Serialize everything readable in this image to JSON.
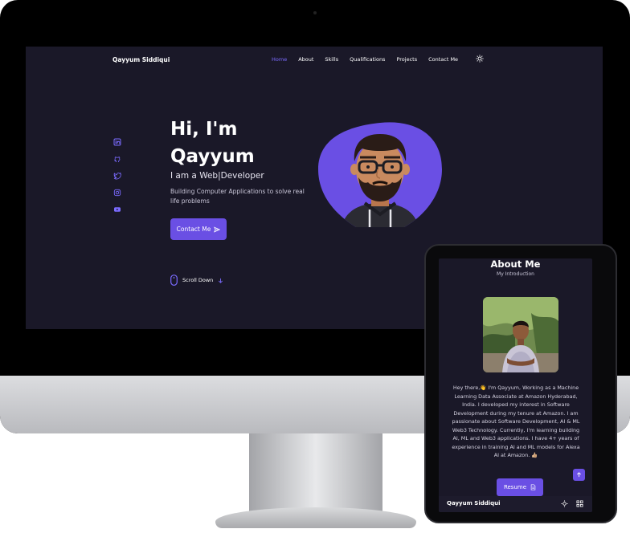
{
  "desktop": {
    "brand": "Qayyum Siddiqui",
    "nav": [
      "Home",
      "About",
      "Skills",
      "Qualifications",
      "Projects",
      "Contact Me"
    ],
    "active_nav": "Home",
    "socials": [
      "linkedin-icon",
      "github-icon",
      "twitter-icon",
      "instagram-icon",
      "youtube-icon"
    ],
    "hero": {
      "title_line1": "Hi, I'm",
      "title_line2": "Qayyum",
      "subtitle": "I am a Web|Developer",
      "description": "Building Computer Applications to solve real life problems",
      "contact_button": "Contact Me"
    },
    "scroll_down": "Scroll Down"
  },
  "tablet": {
    "section_title": "About Me",
    "section_subtitle": "My Introduction",
    "about_text": "Hey there,👋 I'm Qayyum, Working as a Machine Learning Data Associate at Amazon Hyderabad, India. I developed my interest in Software Development during my tenure at Amazon. I am passionate about Software Development, AI & ML Web3 Technology. Currently, I'm learning building AI, ML and Web3 applications. I have 4+ years of experience in training AI and ML models for Alexa AI at Amazon. 👍🏼",
    "resume_button": "Resume",
    "bottom_brand": "Qayyum Siddiqui"
  },
  "colors": {
    "accent": "#6a4fe4",
    "bg": "#1a1828",
    "active_link": "#7b6bff"
  }
}
